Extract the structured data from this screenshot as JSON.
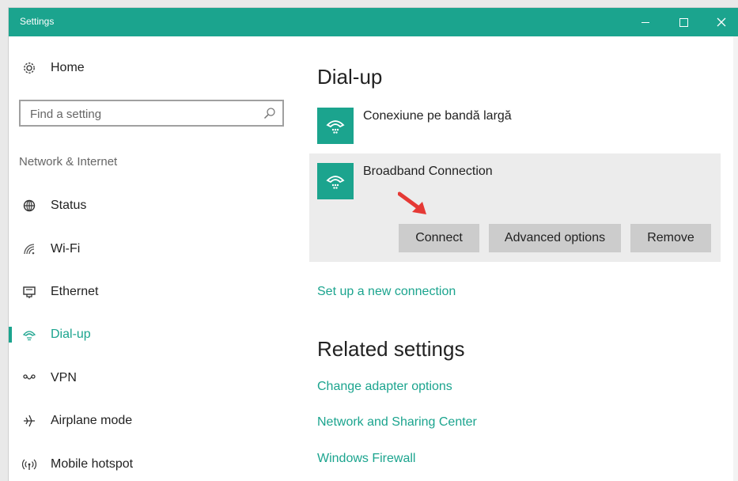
{
  "window": {
    "title": "Settings",
    "controls": [
      "minimize-icon",
      "maximize-icon",
      "close-icon"
    ],
    "accent_color": "#1ba48e"
  },
  "sidebar": {
    "home_label": "Home",
    "search": {
      "placeholder": "Find a setting",
      "value": ""
    },
    "section_label": "Network & Internet",
    "items": [
      {
        "label": "Status",
        "icon": "globe-status-icon",
        "active": false
      },
      {
        "label": "Wi-Fi",
        "icon": "wifi-icon",
        "active": false
      },
      {
        "label": "Ethernet",
        "icon": "ethernet-icon",
        "active": false
      },
      {
        "label": "Dial-up",
        "icon": "dialup-phone-icon",
        "active": true
      },
      {
        "label": "VPN",
        "icon": "vpn-icon",
        "active": false
      },
      {
        "label": "Airplane mode",
        "icon": "airplane-icon",
        "active": false
      },
      {
        "label": "Mobile hotspot",
        "icon": "hotspot-icon",
        "active": false
      }
    ]
  },
  "main": {
    "title": "Dial-up",
    "connections": [
      {
        "name": "Conexiune pe bandă largă",
        "icon": "dialup-phone-icon"
      },
      {
        "name": "Broadband Connection",
        "icon": "dialup-phone-icon",
        "expanded": true
      }
    ],
    "actions": {
      "connect": "Connect",
      "advanced": "Advanced options",
      "remove": "Remove"
    },
    "setup_link": "Set up a new connection",
    "related_title": "Related settings",
    "related_links": [
      "Change adapter options",
      "Network and Sharing Center",
      "Windows Firewall"
    ]
  }
}
